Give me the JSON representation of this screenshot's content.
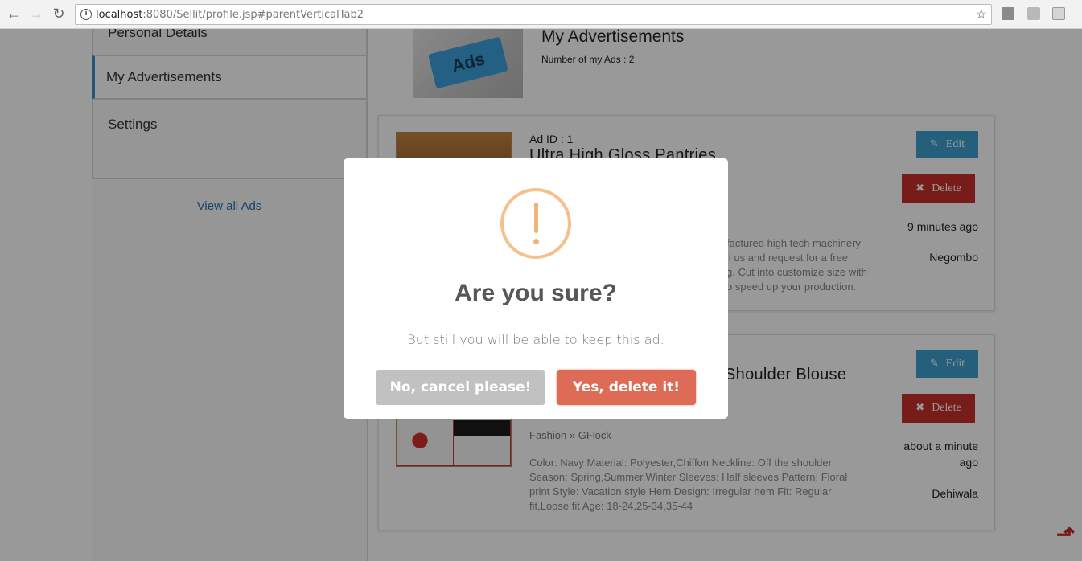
{
  "browser": {
    "url_host": "localhost",
    "url_rest": ":8080/Sellit/profile.jsp#parentVerticalTab2"
  },
  "sidebar": {
    "tabs": [
      {
        "label": "Personal Details"
      },
      {
        "label": "My Advertisements"
      },
      {
        "label": "Settings"
      }
    ],
    "view_all": "View all Ads"
  },
  "header": {
    "title": "My Advertisements",
    "count": "Number of my Ads : 2",
    "image_text": "Ads"
  },
  "ads": [
    {
      "id_label": "Ad ID : 1",
      "title": "Ultra High Gloss Pantries",
      "description": "factured high tech machinery\nll us and request for a free\ng. Cut into customize size with\no speed up your production.",
      "time": "9 minutes ago",
      "location": "Negombo",
      "edit_label": "Edit",
      "delete_label": "Delete"
    },
    {
      "title": "Shoulder Blouse",
      "category": "Fashion » GFlock",
      "description": "Color: Navy Material: Polyester,Chiffon Neckline: Off the shoulder Season: Spring,Summer,Winter Sleeves: Half sleeves Pattern: Floral print Style: Vacation style Hem Design: Irregular hem Fit: Regular fit,Loose fit Age: 18-24,25-34,35-44",
      "time": "about a minute ago",
      "location": "Dehiwala",
      "edit_label": "Edit",
      "delete_label": "Delete"
    }
  ],
  "modal": {
    "title": "Are you sure?",
    "text": "But still you will be able to keep this ad.",
    "cancel_label": "No, cancel please!",
    "confirm_label": "Yes, delete it!"
  },
  "colors": {
    "confirm": "#dd6b55",
    "cancel": "#c1c1c1",
    "warning": "#f5c08a",
    "edit": "#3d9ecf",
    "delete": "#c6302b",
    "active_tab": "#3a8fc7"
  }
}
